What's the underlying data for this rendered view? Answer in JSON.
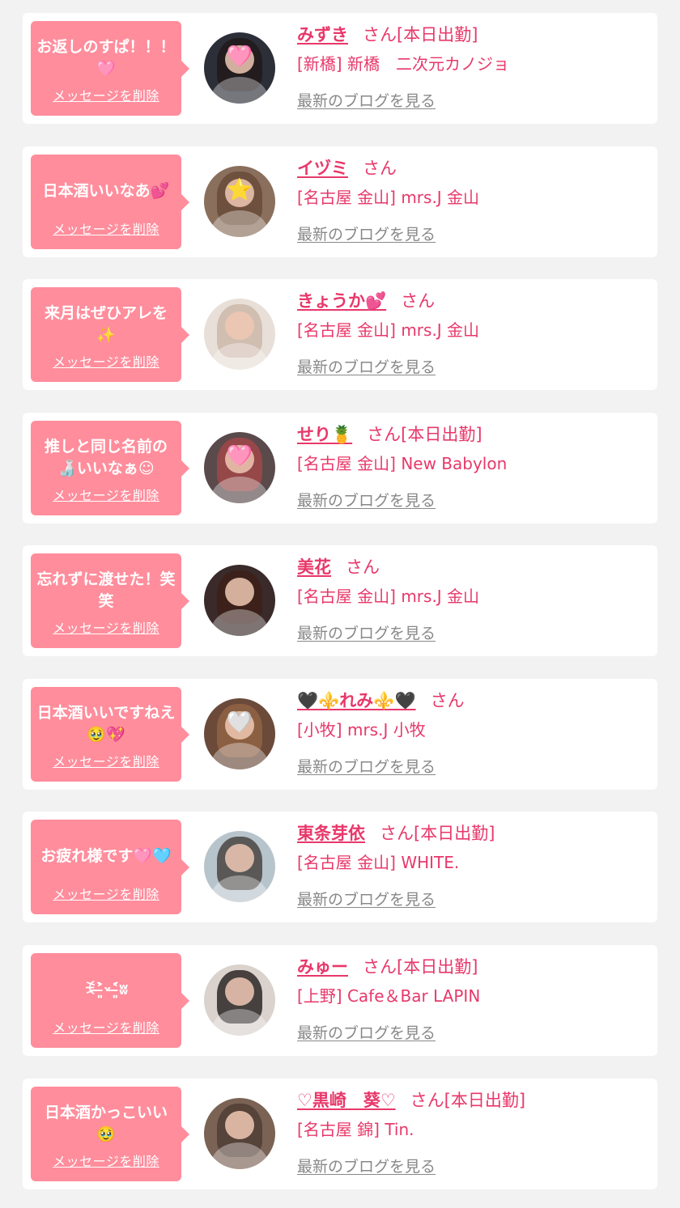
{
  "colors": {
    "background": "#f2f2f2",
    "card": "#ffffff",
    "bubble": "#ff8d9c",
    "accent_text": "#e8386a",
    "link_gray": "#888888"
  },
  "messages": [
    {
      "message": "お返しのすぱ！！！🩷",
      "delete_label": "メッセージを削除",
      "name": "みずき",
      "honorific": "さん[本日出勤]",
      "shop": "[新橋] 新橋　二次元カノジョ",
      "blog_label": "最新のブログを見る",
      "avatar": {
        "bg": "#2c2f38",
        "hair": "rgba(30,20,20,0.7)",
        "sticker": "🩷",
        "sticker_color": "#ffd6e6"
      }
    },
    {
      "message": "日本酒いいなあ💕",
      "delete_label": "メッセージを削除",
      "name": "イヅミ",
      "honorific": "さん",
      "shop": "[名古屋 金山] mrs.J 金山",
      "blog_label": "最新のブログを見る",
      "avatar": {
        "bg": "#8a6f5c",
        "hair": "rgba(90,60,40,0.6)",
        "sticker": "⭐",
        "sticker_color": "#ffe066"
      }
    },
    {
      "message": "来月はぜひアレを✨",
      "delete_label": "メッセージを削除",
      "name": "きょうか💕",
      "honorific": "さん",
      "shop": "[名古屋 金山] mrs.J 金山",
      "blog_label": "最新のブログを見る",
      "avatar": {
        "bg": "#e8dfd8",
        "hair": "rgba(180,150,130,0.45)",
        "sticker": "",
        "sticker_color": ""
      }
    },
    {
      "message": "推しと同じ名前の🍶いいなぁ☺",
      "delete_label": "メッセージを削除",
      "name": "せり🍍",
      "honorific": "さん[本日出勤]",
      "shop": "[名古屋 金山] New Babylon",
      "blog_label": "最新のブログを見る",
      "avatar": {
        "bg": "#5a4a4c",
        "hair": "rgba(200,70,70,0.55)",
        "sticker": "🩷",
        "sticker_color": "#ffc4dc"
      }
    },
    {
      "message": "忘れずに渡せた！笑笑",
      "delete_label": "メッセージを削除",
      "name": "美花",
      "honorific": "さん",
      "shop": "[名古屋 金山] mrs.J 金山",
      "blog_label": "最新のブログを見る",
      "avatar": {
        "bg": "#3a2a2a",
        "hair": "rgba(60,30,20,0.7)",
        "sticker": "",
        "sticker_color": ""
      }
    },
    {
      "message": "日本酒いいですねえ🥹💖",
      "delete_label": "メッセージを削除",
      "name": "🖤⚜️れみ⚜️🖤",
      "honorific": "さん",
      "shop": "[小牧] mrs.J 小牧",
      "blog_label": "最新のブログを見る",
      "avatar": {
        "bg": "#6b4a3a",
        "hair": "rgba(160,110,70,0.6)",
        "sticker": "🤍",
        "sticker_color": "#ffffff"
      }
    },
    {
      "message": "お疲れ様です🩷🩵",
      "delete_label": "メッセージを削除",
      "name": "東条芽依",
      "honorific": "さん[本日出勤]",
      "shop": "[名古屋 金山] WHITE.",
      "blog_label": "最新のブログを見る",
      "avatar": {
        "bg": "#b8c4cc",
        "hair": "rgba(40,30,25,0.65)",
        "sticker": "",
        "sticker_color": ""
      }
    },
    {
      "message": "ꉂ˃̶͈̀ᵕ˂̶͈́ʬ",
      "delete_label": "メッセージを削除",
      "name": "みゅー",
      "honorific": "さん[本日出勤]",
      "shop": "[上野] Cafe＆Bar LAPIN",
      "blog_label": "最新のブログを見る",
      "avatar": {
        "bg": "#d9d2cd",
        "hair": "rgba(20,15,15,0.75)",
        "sticker": "",
        "sticker_color": ""
      }
    },
    {
      "message": "日本酒かっこいい🥹",
      "delete_label": "メッセージを削除",
      "name": "♡黒崎　葵♡",
      "honorific": "さん[本日出勤]",
      "shop": "[名古屋 錦] Tin.",
      "blog_label": "最新のブログを見る",
      "avatar": {
        "bg": "#7a6255",
        "hair": "rgba(50,35,30,0.5)",
        "sticker": "",
        "sticker_color": ""
      }
    }
  ]
}
